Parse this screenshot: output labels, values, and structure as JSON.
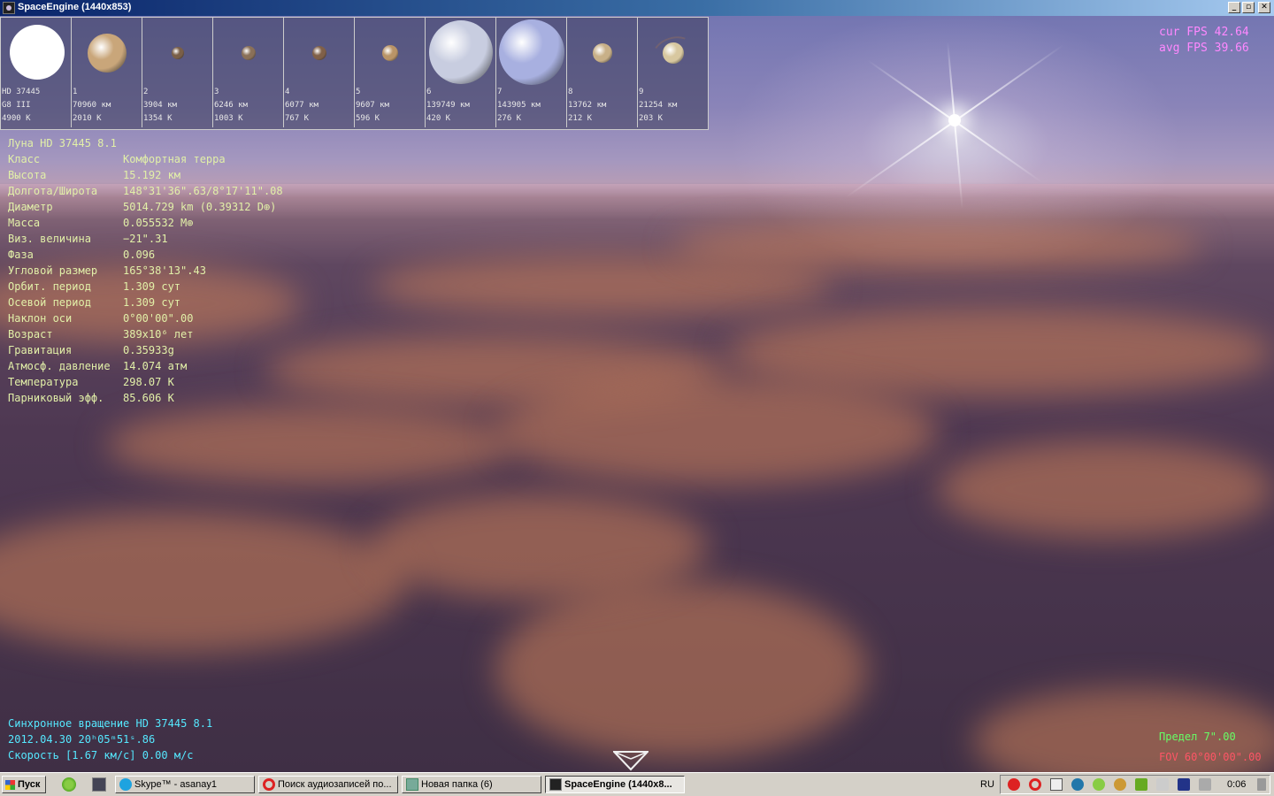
{
  "window": {
    "title": "SpaceEngine (1440x853)",
    "min": "_",
    "restore": "▫",
    "close": "✕"
  },
  "thumbnails": [
    {
      "id": "HD 37445",
      "line2": "G8 III",
      "line3": "4900 K",
      "color": "#ffffff"
    },
    {
      "id": "1",
      "line2": "70960 км",
      "line3": "2010 K",
      "color": "#c9a67a"
    },
    {
      "id": "2",
      "line2": "3904 км",
      "line3": "1354 K",
      "color": "#7a5f48"
    },
    {
      "id": "3",
      "line2": "6246 км",
      "line3": "1003 K",
      "color": "#8a7058"
    },
    {
      "id": "4",
      "line2": "6077 км",
      "line3": "767 K",
      "color": "#806048"
    },
    {
      "id": "5",
      "line2": "9607 км",
      "line3": "596 K",
      "color": "#b99467"
    },
    {
      "id": "6",
      "line2": "139749 км",
      "line3": "420 K",
      "color": "#c8cde0"
    },
    {
      "id": "7",
      "line2": "143905 км",
      "line3": "276 K",
      "color": "#a8b0e0"
    },
    {
      "id": "8",
      "line2": "13762 км",
      "line3": "212 K",
      "color": "#c8b088"
    },
    {
      "id": "9",
      "line2": "21254 км",
      "line3": "203 K",
      "color": "#d8c8a0"
    }
  ],
  "info": {
    "header": "Луна   HD 37445 8.1",
    "rows": [
      {
        "k": "Класс",
        "v": "Комфортная терра"
      },
      {
        "k": "Высота",
        "v": "15.192 км"
      },
      {
        "k": "Долгота/Широта",
        "v": "148°31'36\".63/8°17'11\".08"
      },
      {
        "k": "Диаметр",
        "v": "5014.729 km (0.39312 D⊕)"
      },
      {
        "k": "Масса",
        "v": "0.055532 M⊕"
      },
      {
        "k": "Виз. величина",
        "v": "−21\".31"
      },
      {
        "k": "Фаза",
        "v": "0.096"
      },
      {
        "k": "Угловой размер",
        "v": "165°38'13\".43"
      },
      {
        "k": "Орбит. период",
        "v": "1.309 сут"
      },
      {
        "k": "Осевой период",
        "v": "1.309 сут"
      },
      {
        "k": "Наклон оси",
        "v": "0°00'00\".00"
      },
      {
        "k": "Возраст",
        "v": "389x10⁶ лет"
      },
      {
        "k": "Гравитация",
        "v": "0.35933g"
      },
      {
        "k": "Атмосф. давление",
        "v": "14.074 атм"
      },
      {
        "k": "Температура",
        "v": "298.07 K"
      },
      {
        "k": "Парниковый эфф.",
        "v": "85.606 K"
      }
    ]
  },
  "fps": {
    "cur": "cur  FPS  42.64",
    "avg": "avg  FPS  39.66"
  },
  "status": {
    "line1": "Синхронное вращение HD 37445 8.1",
    "line2": "2012.04.30  20ʰ05ᵐ51ˢ.86",
    "line3": "Скорость [1.67 км/с] 0.00 м/с",
    "limit": "Предел     7\".00",
    "fov": "FOV  60°00'00\".00"
  },
  "taskbar": {
    "start": "Пуск",
    "tasks": [
      {
        "label": "Skype™ - asanay1"
      },
      {
        "label": "Поиск аудиозаписей по..."
      },
      {
        "label": "Новая папка (6)"
      },
      {
        "label": "SpaceEngine (1440x8..."
      }
    ],
    "lang": "RU",
    "clock": "0:06"
  }
}
